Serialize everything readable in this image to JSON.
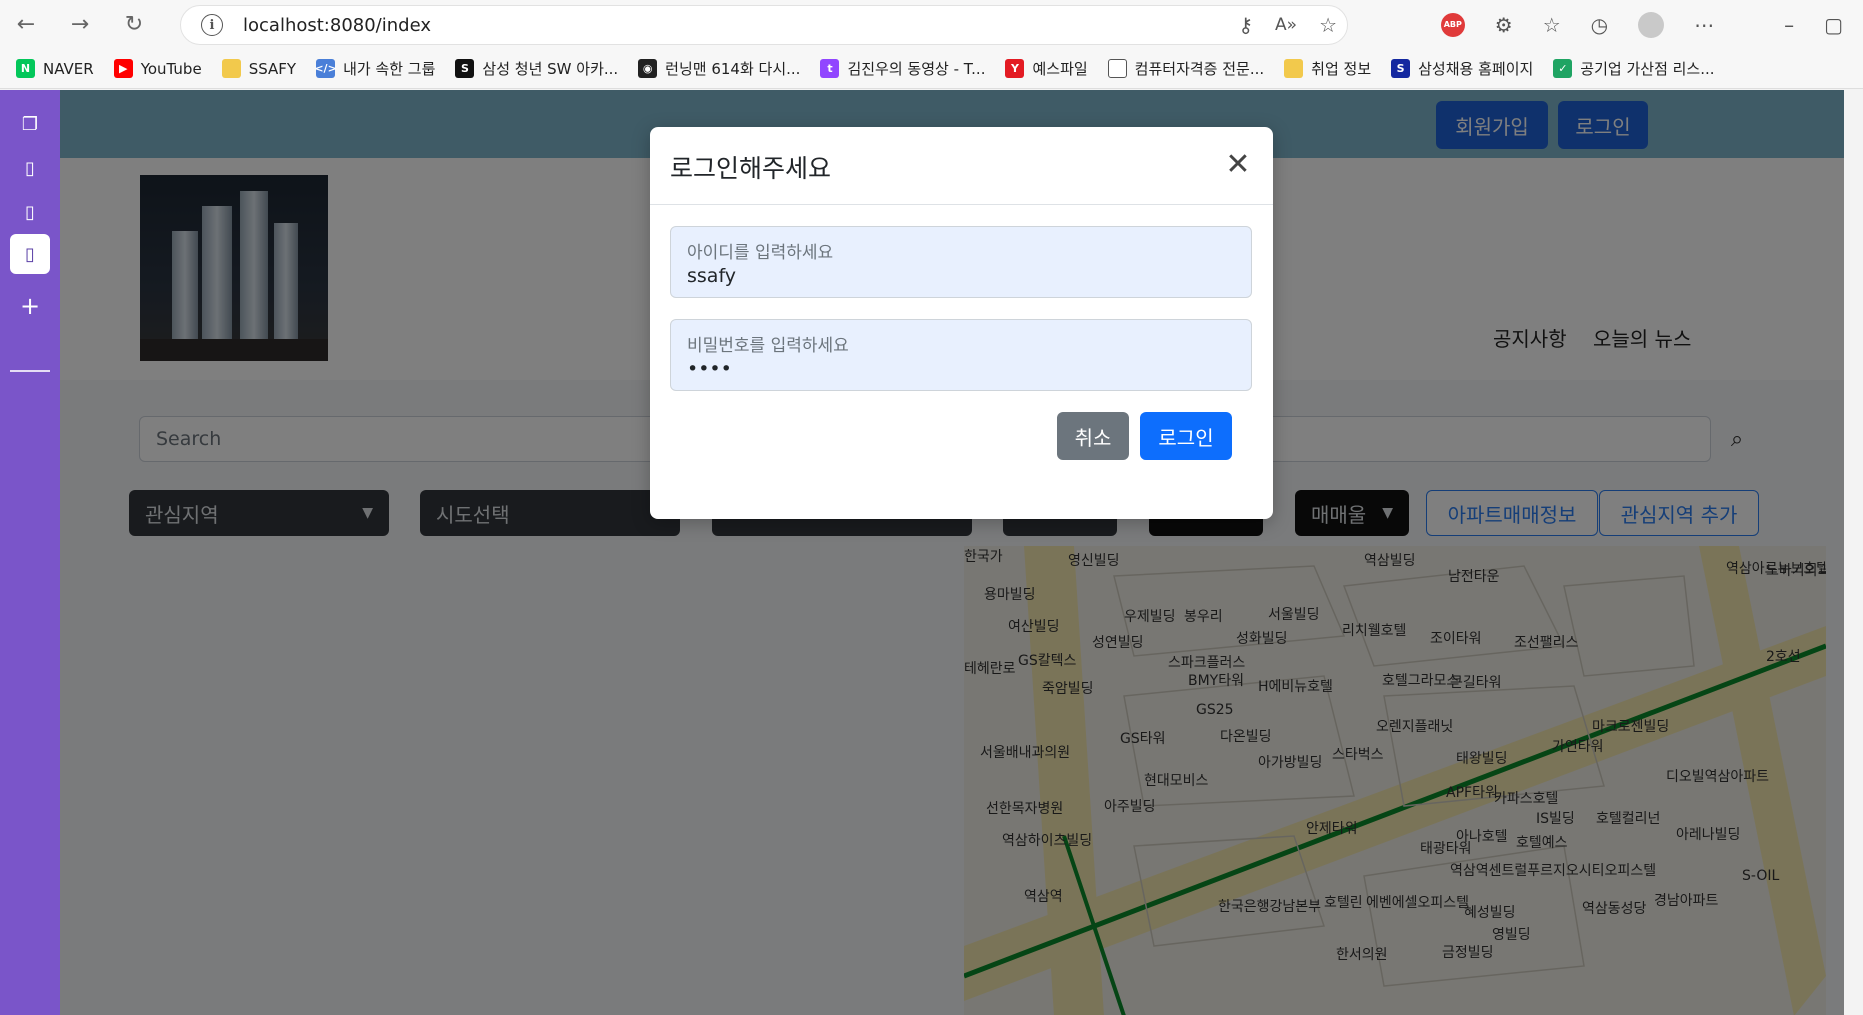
{
  "browser": {
    "url": "localhost:8080/index",
    "nav": {
      "back_icon": "back-arrow-icon",
      "forward_icon": "forward-arrow-icon",
      "reload_icon": "reload-icon"
    },
    "extension_badge": "ABP",
    "bookmarks": [
      {
        "label": "NAVER",
        "icon_text": "N",
        "color": "#03c75a"
      },
      {
        "label": "YouTube",
        "icon_text": "▶",
        "color": "#ff0000"
      },
      {
        "label": "SSAFY",
        "icon_text": "",
        "color": "#f2c94c"
      },
      {
        "label": "내가 속한 그룹",
        "icon_text": "</>",
        "color": "#4a7fd8"
      },
      {
        "label": "삼성 청년 SW 아카...",
        "icon_text": "S",
        "color": "#111111"
      },
      {
        "label": "런닝맨 614화 다시...",
        "icon_text": "◉",
        "color": "#222222"
      },
      {
        "label": "김진우의 동영상 - T...",
        "icon_text": "t",
        "color": "#9146ff"
      },
      {
        "label": "예스파일",
        "icon_text": "Y",
        "color": "#e31b23"
      },
      {
        "label": "컴퓨터자격증 전문...",
        "icon_text": "",
        "color": "#ffffff"
      },
      {
        "label": "취업 정보",
        "icon_text": "",
        "color": "#f2c94c"
      },
      {
        "label": "삼성채용 홈페이지",
        "icon_text": "S",
        "color": "#1428a0"
      },
      {
        "label": "공기업 가산점 리스...",
        "icon_text": "✓",
        "color": "#1fa463"
      }
    ]
  },
  "header": {
    "signup_label": "회원가입",
    "login_label": "로그인"
  },
  "topnav": {
    "notice": "공지사항",
    "news": "오늘의 뉴스"
  },
  "search": {
    "placeholder": "Search"
  },
  "filters": {
    "interest_region": "관심지역",
    "sido": "시도선택",
    "deal_type": "매매울"
  },
  "buttons": {
    "apt_info": "아파트매매정보",
    "add_interest": "관심지역 추가"
  },
  "map_labels": [
    "영신빌딩",
    "역삼빌딩",
    "남전타운",
    "역삼아르누보호텔",
    "용마빌딩",
    "우제빌딩",
    "봉우리",
    "서울빌딩",
    "리치웰호텔",
    "조이타워",
    "조선팰리스",
    "여산빌딩",
    "성연빌딩",
    "성화빌딩",
    "GS칼텍스",
    "스파크플러스",
    "BMY타워",
    "H에비뉴호텔",
    "호텔그라모스",
    "큰길타워",
    "죽암빌딩",
    "GS25",
    "오렌지플래닛",
    "마크로젠빌딩",
    "GS타워",
    "다온빌딩",
    "스타벅스",
    "가연타워",
    "서울배내과의원",
    "아가방빌딩",
    "태왕빌딩",
    "현대모비스",
    "APF타워",
    "카파스호텔",
    "디오빌역삼아파트",
    "아주빌딩",
    "선한목자병원",
    "IS빌딩",
    "호텔컬리넌",
    "안제타워",
    "아나호텔",
    "호텔예스",
    "아레나빌딩",
    "역삼하이츠빌딩",
    "태광타워",
    "역삼역센트럴푸르지오시티오피스텔",
    "S-OIL",
    "역삼역",
    "한국은행강남본부",
    "호텔린",
    "에벤에셀오피스텔",
    "혜성빌딩",
    "역삼동성당",
    "경남아파트",
    "영빌딩",
    "한서의원",
    "금정빌딩",
    "2호선",
    "테헤란로",
    "노바기외과의원",
    "한국가"
  ],
  "modal": {
    "title": "로그인해주세요",
    "id_label": "아이디를 입력하세요",
    "id_value": "ssafy",
    "pw_label": "비밀번호를 입력하세요",
    "pw_value": "••••",
    "cancel_label": "취소",
    "login_label": "로그인"
  },
  "colors": {
    "header": "#7fb6cc",
    "primary": "#0d6efd",
    "secondary": "#6c757d",
    "tab_strip": "#7a55c9",
    "input_autofill": "#e8f0fe"
  }
}
